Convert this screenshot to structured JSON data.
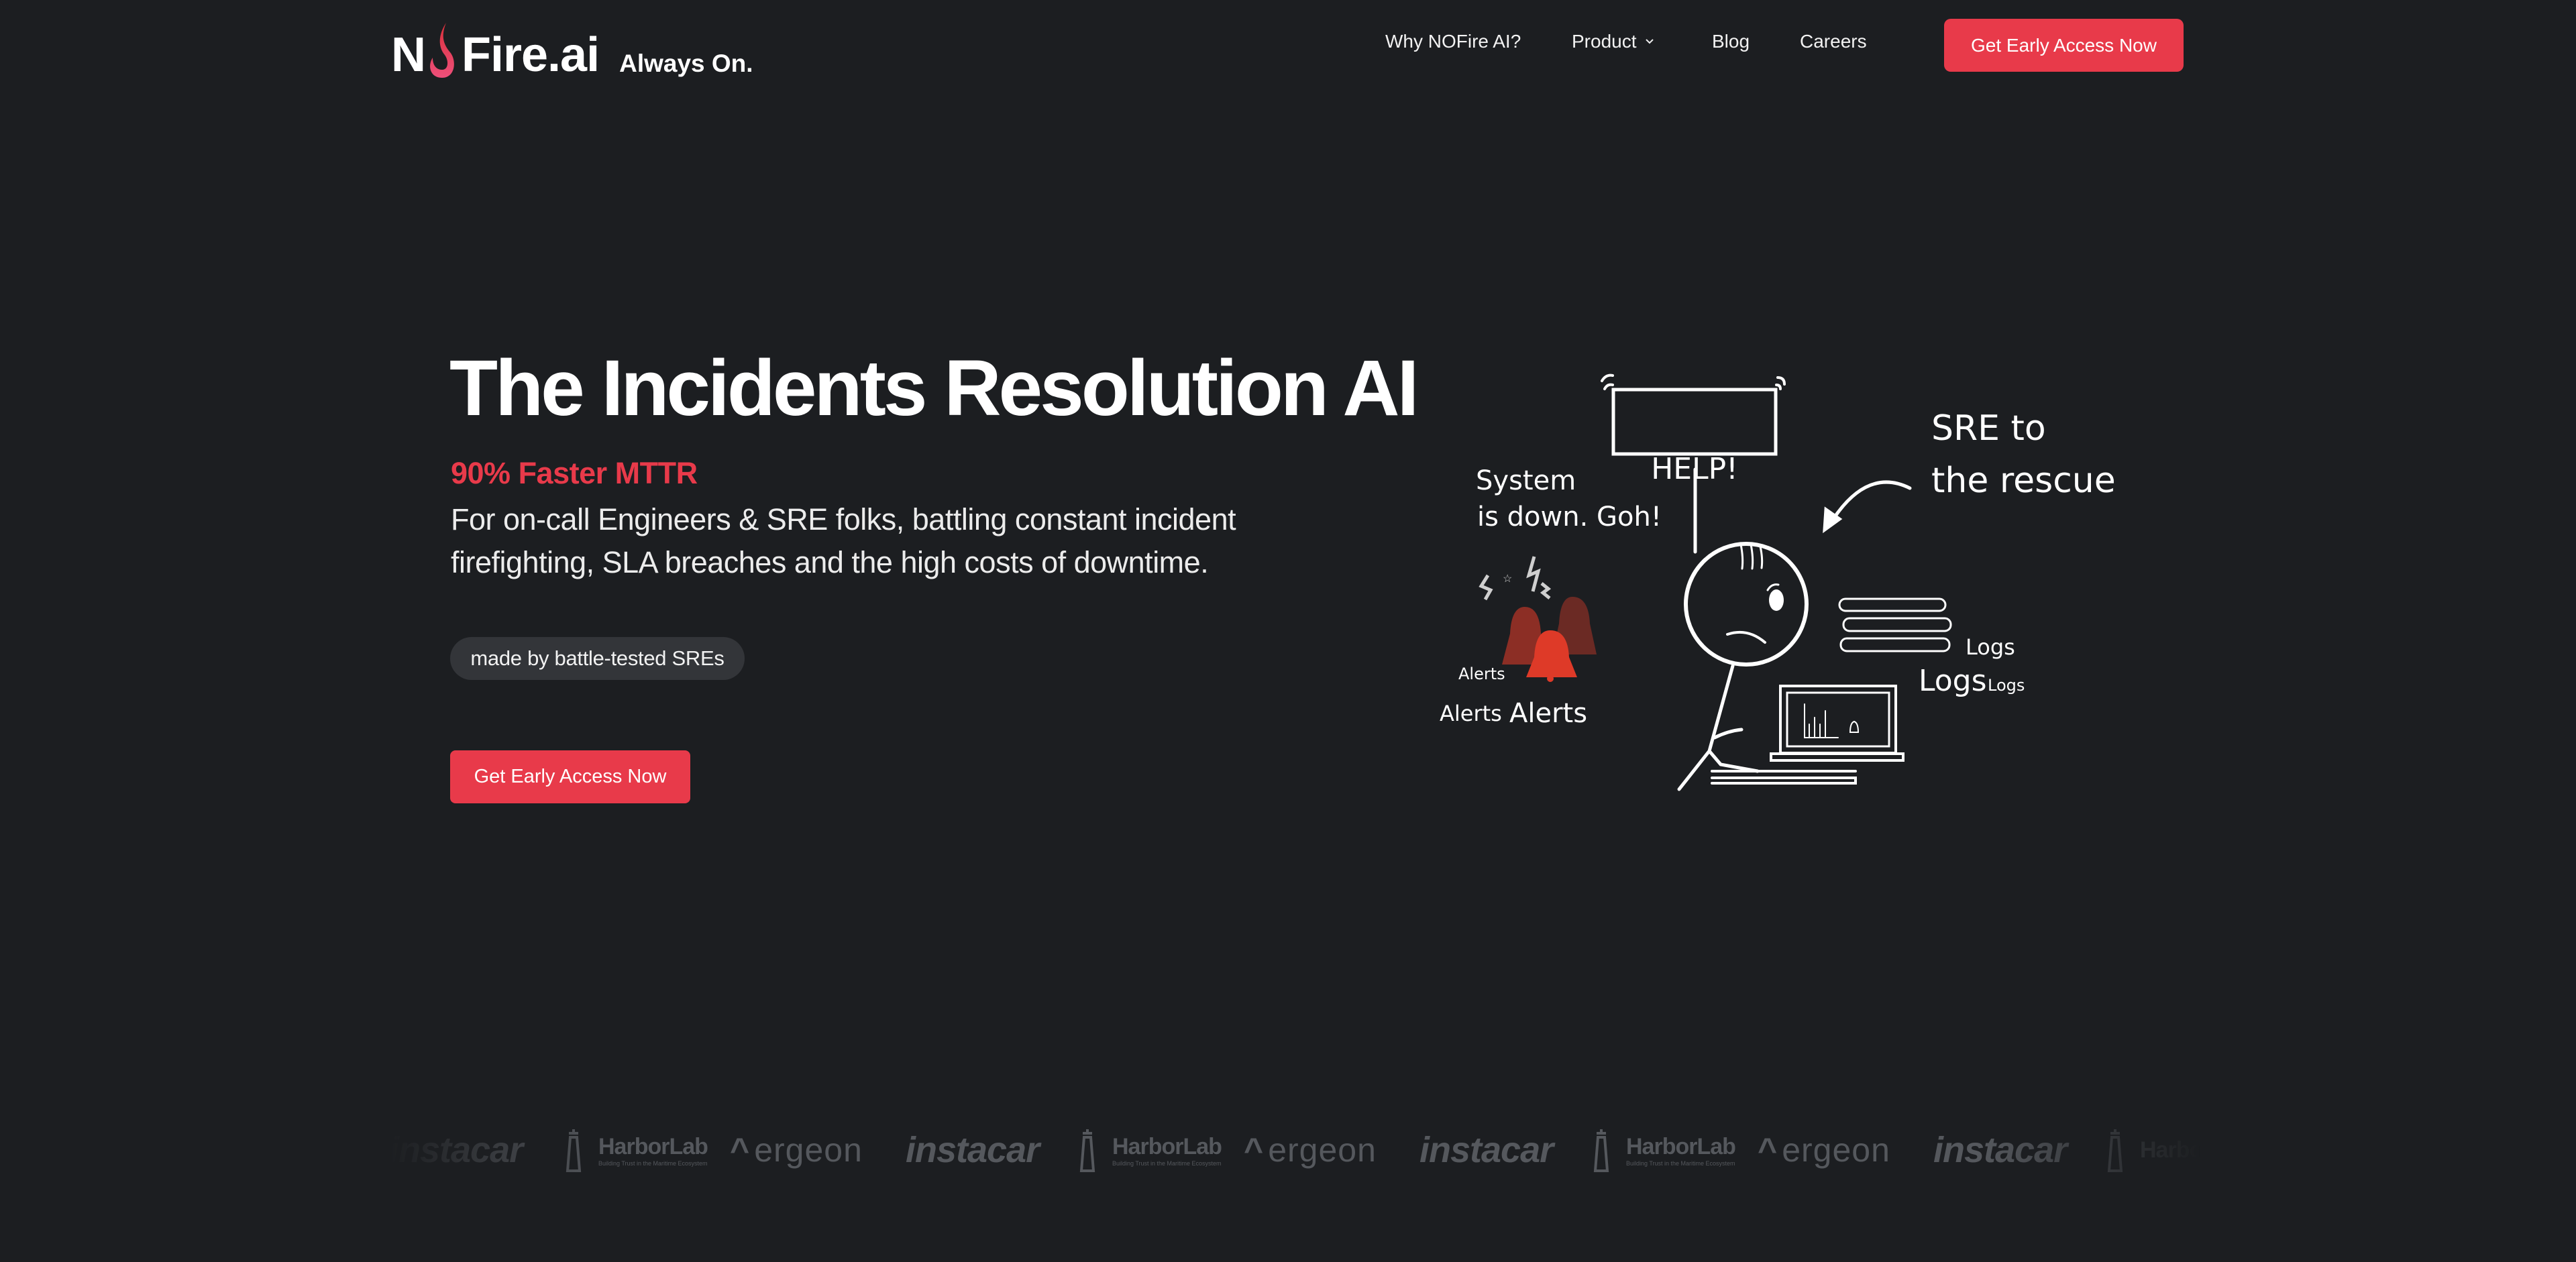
{
  "header": {
    "logo": {
      "text_before": "N",
      "text_after": "Fire.ai",
      "tagline": "Always On."
    },
    "nav": [
      {
        "label": "Why NOFire AI?"
      },
      {
        "label": "Product",
        "has_dropdown": true,
        "icon": "chevron-down-icon"
      },
      {
        "label": "Blog"
      },
      {
        "label": "Careers"
      }
    ],
    "cta_label": "Get Early Access Now"
  },
  "hero": {
    "title": "The Incidents Resolution AI",
    "highlight": "90% Faster MTTR",
    "description_line1": "For on-call Engineers & SRE folks, battling constant incident",
    "description_line2": "firefighting, SLA breaches and the high costs of downtime.",
    "badge": "made by battle-tested SREs",
    "cta_label": "Get Early Access Now"
  },
  "illustration": {
    "sign": "HELP!",
    "system_line1": "System",
    "system_line2": "is down. Goh!",
    "rescue_line1": "SRE to",
    "rescue_line2": "the rescue",
    "alerts_small": "Alerts",
    "alerts_1": "Alerts",
    "alerts_2": "Alerts",
    "logs_1": "Logs",
    "logs_2": "Logs",
    "logs_3": "Logs"
  },
  "logos": {
    "instacar": "instacar",
    "harborlab": "HarborLab",
    "harborlab_sub": "Building Trust in the Maritime Ecosystem",
    "ergeon": "ergeon"
  },
  "colors": {
    "background": "#1c1e21",
    "accent": "#e83a4a",
    "pill": "#333539",
    "logo_gray": "#55585d"
  }
}
